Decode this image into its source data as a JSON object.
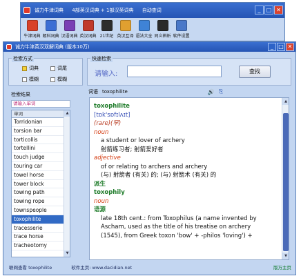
{
  "top_window": {
    "title_segments": [
      "诚力牛津词典",
      "4部英汉词典 + 1部汉英词典",
      "自动查词"
    ],
    "tools": [
      {
        "label": "牛津词典",
        "icon": "oxford-book-icon",
        "color": "#d8412a"
      },
      {
        "label": "朗科词典",
        "icon": "longman-book-icon",
        "color": "#3b6ed4"
      },
      {
        "label": "汉语词典",
        "icon": "chinese-dict-icon",
        "color": "#7a3fb5"
      },
      {
        "label": "英汉词典",
        "icon": "ae-dict-icon",
        "color": "#c0392b"
      },
      {
        "label": "21世纪",
        "icon": "century-dict-icon",
        "color": "#2d2d2d"
      },
      {
        "label": "英汉互译",
        "icon": "translate-icon",
        "color": "#e0a030"
      },
      {
        "label": "语法大全",
        "icon": "grammar-icon",
        "color": "#3f83d6"
      },
      {
        "label": "同义辨析",
        "icon": "synonym-icon",
        "color": "#2a2a2a"
      },
      {
        "label": "软件设置",
        "icon": "settings-icon",
        "color": "#4a78c8"
      }
    ]
  },
  "main_window": {
    "title": "诚力牛津英汉双解词典 (版本10万)",
    "search_mode_title": "检索方式",
    "search_modes": [
      {
        "label": "词典",
        "selected": true
      },
      {
        "label": "词尾",
        "selected": false
      },
      {
        "label": "模糊",
        "selected": false
      },
      {
        "label": "模糊",
        "selected": false
      }
    ],
    "search_section_title": "快速检索",
    "search_label": "请输入:",
    "search_value": "",
    "search_button": "查找",
    "results_title": "检索结果",
    "filter_text": "请输入单词",
    "list_header": "单词",
    "word_list": [
      "Torridonian",
      "torsion bar",
      "torticollis",
      "tortellini",
      "touch judge",
      "touring car",
      "towel horse",
      "tower block",
      "towing path",
      "towing rope",
      "townspeople",
      "toxophilite",
      "tracesserie",
      "trace horse",
      "tracheotomy"
    ],
    "selected_word": "toxophilite",
    "definition_title": "词语",
    "definition_word": "toxophilite"
  },
  "definition": {
    "headword": "toxophilite",
    "phonetic": "[tɒk'sɒfɪlʌɪt]",
    "register": "(rare)(罕)",
    "pos1": "noun",
    "sense1_en": "a student or lover of archery",
    "sense1_cn": "射箭练习者; 射箭爱好者",
    "pos2": "adjective",
    "sense2_en": "of or relating to archers and archery",
    "sense2_cn": "(与) 射箭者 (有关) 的; (与) 射箭术 (有关) 的",
    "derivative_title": "派生",
    "derivative_word": "toxophily",
    "derivative_pos": "noun",
    "origin_title": "语源",
    "origin_line1": "late 18th cent.: from Toxophilus (a name invented by",
    "origin_line2": "Ascham, used as the title of his treatise on archery",
    "origin_line3": "(1545), from Greek toxon 'bow' + -philos 'loving') +"
  },
  "status": {
    "left": "联网查看 toxophilite",
    "site": "软件主页: www.dacidian.net",
    "right": "版万主页"
  },
  "colors": {
    "titlebar": "#2d5fc4",
    "window_bg": "#c3d6f1",
    "selection": "#316ac5",
    "headword": "#1f7c2a",
    "pos": "#d43a0f"
  }
}
